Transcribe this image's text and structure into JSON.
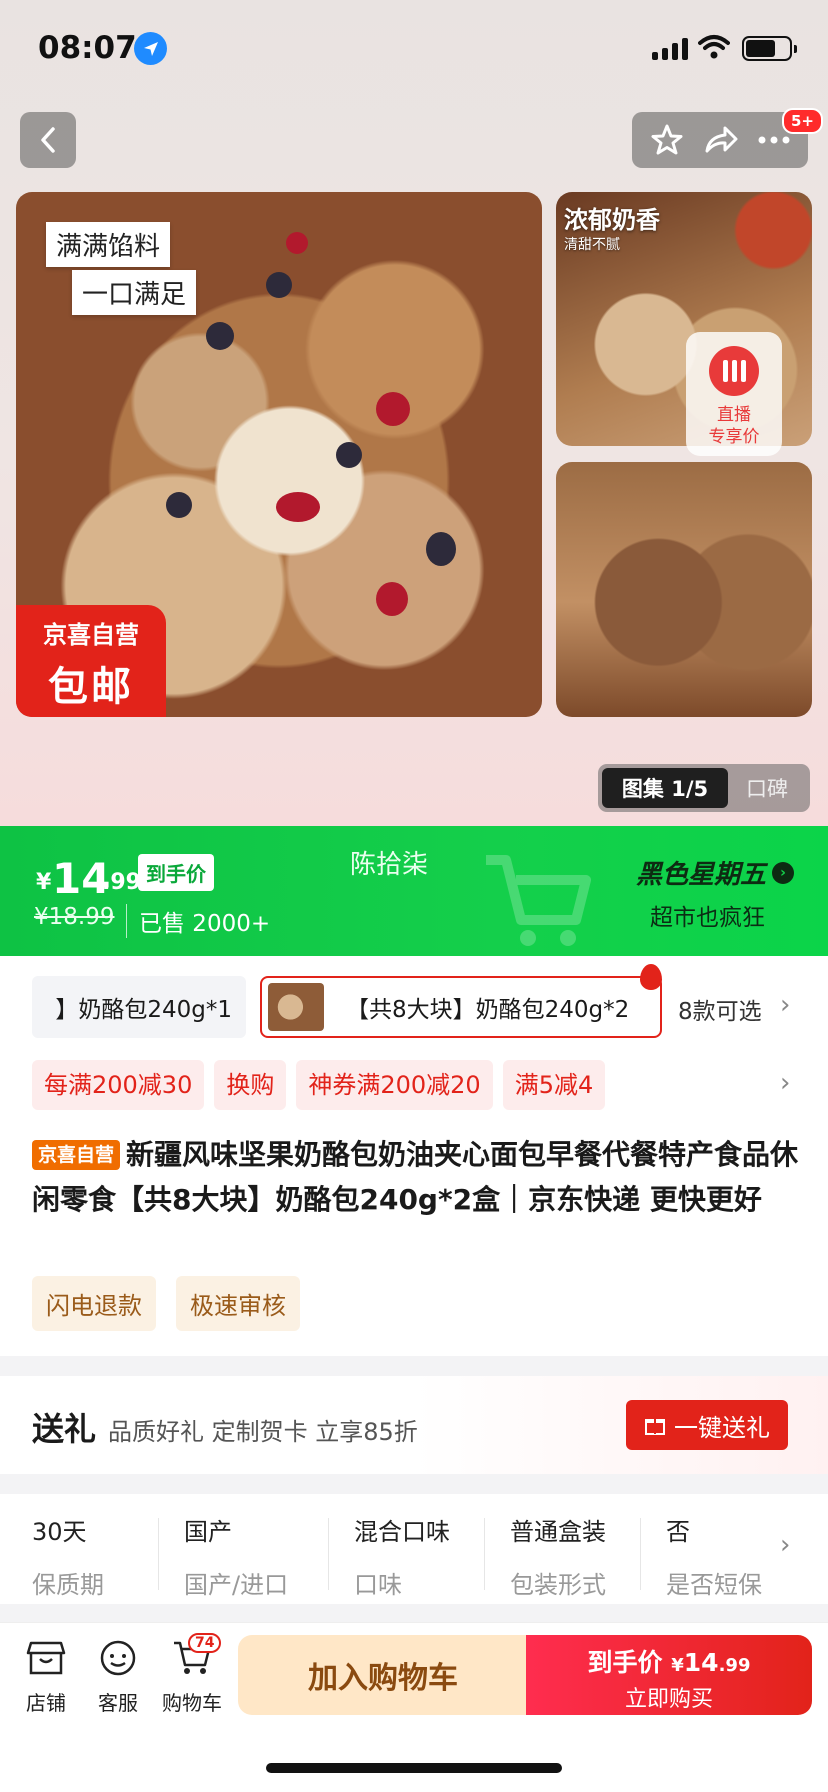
{
  "status": {
    "time": "08:07"
  },
  "nav": {
    "badge": "5+"
  },
  "hero": {
    "main_tag1": "满满馅料",
    "main_tag2": "一口满足",
    "jx_label1": "京喜自营",
    "jx_label2": "包邮",
    "top_title": "浓郁奶香",
    "top_sub": "清甜不腻",
    "live_line1": "直播",
    "live_line2": "专享价",
    "gallery_label": "图集 1/5",
    "reviews_label": "口碑"
  },
  "price": {
    "currency": "¥",
    "int": "14",
    "dec": ".99",
    "tag": "到手价",
    "original": "¥18.99",
    "sold": "已售 2000+",
    "host": "陈拾柒",
    "promo_title": "黑色星期五",
    "promo_sub": "超市也疯狂"
  },
  "variants": [
    {
      "label": "】奶酪包240g*1"
    },
    {
      "label": "【共8大块】奶酪包240g*2"
    }
  ],
  "variants_more": "8款可选",
  "coupons": [
    "每满200减30",
    "换购",
    "神券满200减20",
    "满5减4"
  ],
  "product": {
    "tag": "京喜自营",
    "title": "新疆风味坚果奶酪包奶油夹心面包早餐代餐特产食品休闲零食【共8大块】奶酪包240g*2盒｜京东快递 更快更好",
    "chips": [
      "闪电退款",
      "极速审核"
    ]
  },
  "gift": {
    "title": "送礼",
    "subtitle": "品质好礼 定制贺卡 立享85折",
    "button": "一键送礼"
  },
  "attributes": [
    {
      "value": "30天",
      "key": "保质期"
    },
    {
      "value": "国产",
      "key": "国产/进口"
    },
    {
      "value": "混合口味",
      "key": "口味"
    },
    {
      "value": "普通盒装",
      "key": "包装形式"
    },
    {
      "value": "否",
      "key": "是否短保"
    }
  ],
  "bottom": {
    "store": "店铺",
    "service": "客服",
    "cart": "购物车",
    "cart_count": "74",
    "add_to_cart": "加入购物车",
    "buy_price_label": "到手价",
    "buy_currency": "¥",
    "buy_int": "14",
    "buy_dec": ".99",
    "buy_now": "立即购买"
  },
  "colors": {
    "accent_red": "#e2231a",
    "price_green": "#14cf4b"
  }
}
